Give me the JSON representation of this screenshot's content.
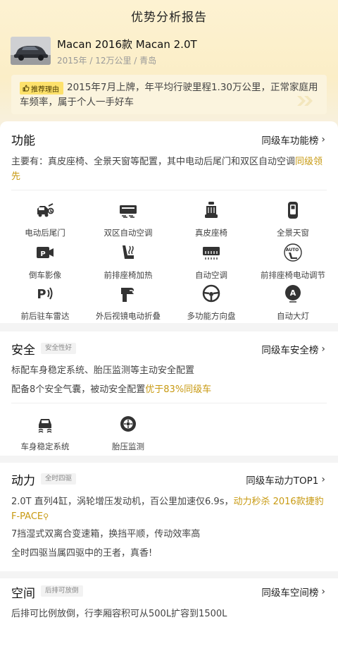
{
  "header": {
    "title": "优势分析报告"
  },
  "car": {
    "name": "Macan 2016款 Macan 2.0T",
    "meta": "2015年 / 12万公里 / 青岛",
    "reason_tag": "推荐理由",
    "reason_text": "2015年7月上牌，年平均行驶里程1.30万公里，正常家庭用车频率，属于个人一手好车"
  },
  "function": {
    "title": "功能",
    "link": "同级车功能榜",
    "desc_plain": "主要有：真皮座椅、全景天窗等配置，其中电动后尾门和双区自动空调",
    "desc_hl": "同级领先",
    "features": [
      {
        "label": "电动后尾门",
        "icon": "power-tailgate-icon"
      },
      {
        "label": "双区自动空调",
        "icon": "dual-zone-ac-icon"
      },
      {
        "label": "真皮座椅",
        "icon": "leather-seat-icon"
      },
      {
        "label": "全景天窗",
        "icon": "panoramic-sunroof-icon"
      },
      {
        "label": "倒车影像",
        "icon": "reverse-camera-icon"
      },
      {
        "label": "前排座椅加热",
        "icon": "seat-heating-icon"
      },
      {
        "label": "自动空调",
        "icon": "auto-ac-icon"
      },
      {
        "label": "前排座椅电动调节",
        "icon": "power-seat-icon"
      },
      {
        "label": "前后驻车雷达",
        "icon": "parking-radar-icon"
      },
      {
        "label": "外后视镜电动折叠",
        "icon": "mirror-fold-icon"
      },
      {
        "label": "多功能方向盘",
        "icon": "steering-wheel-icon"
      },
      {
        "label": "自动大灯",
        "icon": "auto-headlight-icon"
      }
    ]
  },
  "safety": {
    "title": "安全",
    "badge": "安全性好",
    "link": "同级车安全榜",
    "line1": "标配车身稳定系统、胎压监测等主动安全配置",
    "line2_plain": "配备8个安全气囊，被动安全配置",
    "line2_hl": "优于83%同级车",
    "features": [
      {
        "label": "车身稳定系统",
        "icon": "stability-control-icon"
      },
      {
        "label": "胎压监测",
        "icon": "tire-pressure-icon"
      }
    ]
  },
  "power": {
    "title": "动力",
    "badge": "全时四驱",
    "link": "同级车动力TOP1",
    "line1_plain": "2.0T 直列4缸，涡轮增压发动机，百公里加速仅6.9s，",
    "line1_hl": "动力秒杀 2016款捷豹F-PACE",
    "line2": "7挡湿式双离合变速箱，换挡平顺，传动效率高",
    "line3": "全时四驱当属四驱中的王者，真香!"
  },
  "space": {
    "title": "空间",
    "badge": "后排可放倒",
    "link": "同级车空间榜",
    "line1": "后排可比例放倒，行李厢容积可从500L扩容到1500L"
  },
  "colors": {
    "accent": "#c89a12",
    "tag": "#fde16b",
    "icon": "#333333"
  }
}
